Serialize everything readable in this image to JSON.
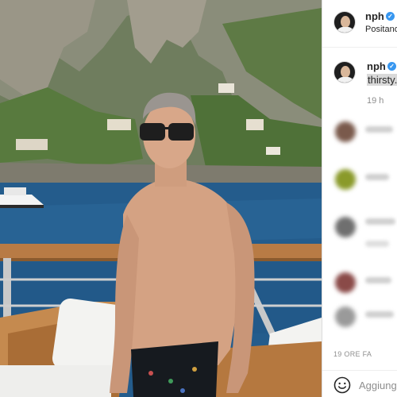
{
  "post": {
    "image_alt": "Shirtless man wearing sunglasses on a boat deck in front of cliffs and sea"
  },
  "header": {
    "username": "nph",
    "location": "Positano",
    "verified_icon": "verified-badge-icon"
  },
  "caption": {
    "username": "nph",
    "text": "thirsty.",
    "time": "19 h"
  },
  "comments": {
    "blurred_count": 6
  },
  "footer": {
    "date": "19 ORE FA",
    "comment_placeholder": "Aggiungi un commento...",
    "emoji_icon": "emoji-smiley-icon"
  },
  "colors": {
    "verified": "#3897f0",
    "text": "#262626",
    "secondary": "#8e8e8e",
    "border": "#dbdbdb"
  }
}
